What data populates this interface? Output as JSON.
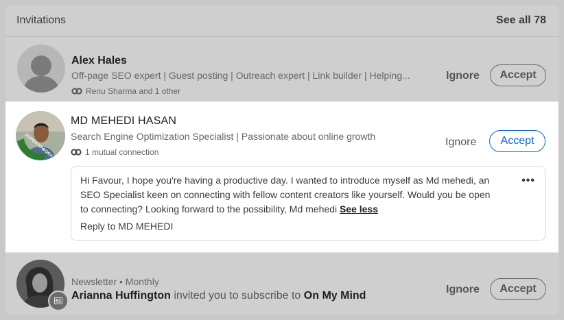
{
  "header": {
    "title": "Invitations",
    "see_all": "See all 78"
  },
  "invitations": [
    {
      "name": "Alex Hales",
      "headline": "Off-page SEO expert | Guest posting | Outreach expert | Link builder | Helping...",
      "mutual": "Renu Sharma and 1 other",
      "ignore": "Ignore",
      "accept": "Accept"
    },
    {
      "name": "MD MEHEDI HASAN",
      "headline": "Search Engine Optimization Specialist | Passionate about online growth",
      "mutual": "1 mutual connection",
      "badge": "#OPENTOWORK",
      "ignore": "Ignore",
      "accept": "Accept",
      "message": {
        "text": "Hi Favour, I hope you're having a productive day. I wanted to introduce myself as Md mehedi, an SEO Specialist keen on connecting with fellow content creators like yourself. Would you be open to connecting? Looking forward to the possibility, Md mehedi",
        "see_less": "See less",
        "reply": "Reply to MD MEHEDI",
        "more_icon": "more-options-icon"
      }
    },
    {
      "label": "Newsletter • Monthly",
      "name": "Arianna Huffington",
      "invite_text": "invited you to subscribe to",
      "newsletter": "On My Mind",
      "ignore": "Ignore",
      "accept": "Accept"
    }
  ],
  "colors": {
    "accent": "#0a66c2",
    "dim_text": "#555555",
    "active_border": "#0a66c2",
    "opentowork": "#2e7d32"
  }
}
